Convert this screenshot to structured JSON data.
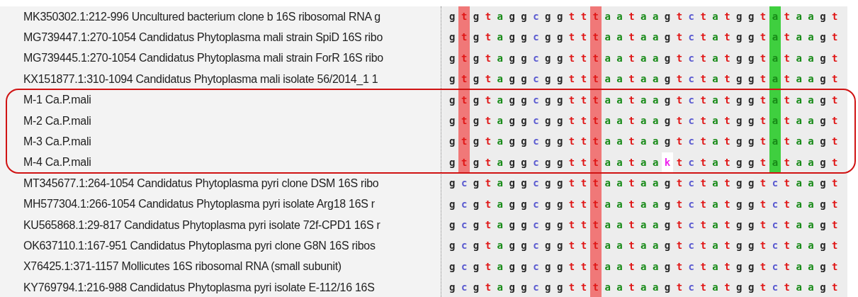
{
  "annotation": {
    "kind": "rounded-frame"
  },
  "rows": [
    {
      "name": "MK350302.1:212-996 Uncultured bacterium clone b 16S ribosomal RNA g",
      "segments": [
        {
          "bases": "g ",
          "highlighted": false
        },
        {
          "bases": "t",
          "highlighted": true,
          "color": "#f07878"
        },
        {
          "bases": " g t a g g c g g t t ",
          "highlighted": false
        },
        {
          "bases": "t",
          "highlighted": true,
          "color": "#f07878"
        },
        {
          "bases": " a a t a a g t c t a t g g t ",
          "highlighted": false
        },
        {
          "bases": "a",
          "highlighted": true,
          "color": "#3fcf3f"
        },
        {
          "bases": " t a a g t",
          "highlighted": false
        }
      ]
    },
    {
      "name": "MG739447.1:270-1054 Candidatus Phytoplasma mali strain SpiD 16S ribo",
      "segments": [
        {
          "bases": "g ",
          "highlighted": false
        },
        {
          "bases": "t",
          "highlighted": true,
          "color": "#f07878"
        },
        {
          "bases": " g t a g g c g g t t ",
          "highlighted": false
        },
        {
          "bases": "t",
          "highlighted": true,
          "color": "#f07878"
        },
        {
          "bases": " a a t a a g t c t a t g g t ",
          "highlighted": false
        },
        {
          "bases": "a",
          "highlighted": true,
          "color": "#3fcf3f"
        },
        {
          "bases": " t a a g t",
          "highlighted": false
        }
      ]
    },
    {
      "name": "MG739445.1:270-1054 Candidatus Phytoplasma mali strain ForR 16S ribo",
      "segments": [
        {
          "bases": "g ",
          "highlighted": false
        },
        {
          "bases": "t",
          "highlighted": true,
          "color": "#f07878"
        },
        {
          "bases": " g t a g g c g g t t ",
          "highlighted": false
        },
        {
          "bases": "t",
          "highlighted": true,
          "color": "#f07878"
        },
        {
          "bases": " a a t a a g t c t a t g g t ",
          "highlighted": false
        },
        {
          "bases": "a",
          "highlighted": true,
          "color": "#3fcf3f"
        },
        {
          "bases": " t a a g t",
          "highlighted": false
        }
      ]
    },
    {
      "name": "KX151877.1:310-1094 Candidatus Phytoplasma mali isolate 56/2014_1 1",
      "segments": [
        {
          "bases": "g ",
          "highlighted": false
        },
        {
          "bases": "t",
          "highlighted": true,
          "color": "#f07878"
        },
        {
          "bases": " g t a g g c g g t t ",
          "highlighted": false
        },
        {
          "bases": "t",
          "highlighted": true,
          "color": "#f07878"
        },
        {
          "bases": " a a t a a g t c t a t g g t ",
          "highlighted": false
        },
        {
          "bases": "a",
          "highlighted": true,
          "color": "#3fcf3f"
        },
        {
          "bases": " t a a g t",
          "highlighted": false
        }
      ]
    },
    {
      "name": "M-1 Ca.P.mali",
      "segments": [
        {
          "bases": "g ",
          "highlighted": false
        },
        {
          "bases": "t",
          "highlighted": true,
          "color": "#f07878"
        },
        {
          "bases": " g t a g g c g g t t ",
          "highlighted": false
        },
        {
          "bases": "t",
          "highlighted": true,
          "color": "#f07878"
        },
        {
          "bases": " a a t a a g t c t a t g g t ",
          "highlighted": false
        },
        {
          "bases": "a",
          "highlighted": true,
          "color": "#3fcf3f"
        },
        {
          "bases": " t a a g t",
          "highlighted": false
        }
      ]
    },
    {
      "name": "M-2 Ca.P.mali",
      "segments": [
        {
          "bases": "g ",
          "highlighted": false
        },
        {
          "bases": "t",
          "highlighted": true,
          "color": "#f07878"
        },
        {
          "bases": " g t a g g c g g t t ",
          "highlighted": false
        },
        {
          "bases": "t",
          "highlighted": true,
          "color": "#f07878"
        },
        {
          "bases": " a a t a a g t c t a t g g t ",
          "highlighted": false
        },
        {
          "bases": "a",
          "highlighted": true,
          "color": "#3fcf3f"
        },
        {
          "bases": " t a a g t",
          "highlighted": false
        }
      ]
    },
    {
      "name": "M-3 Ca.P.mali",
      "segments": [
        {
          "bases": "g ",
          "highlighted": false
        },
        {
          "bases": "t",
          "highlighted": true,
          "color": "#f07878"
        },
        {
          "bases": " g t a g g c g g t t ",
          "highlighted": false
        },
        {
          "bases": "t",
          "highlighted": true,
          "color": "#f07878"
        },
        {
          "bases": " a a t a a g t c t a t g g t ",
          "highlighted": false
        },
        {
          "bases": "a",
          "highlighted": true,
          "color": "#3fcf3f"
        },
        {
          "bases": " t a a g t",
          "highlighted": false
        }
      ]
    },
    {
      "name": "M-4 Ca.P.mali",
      "segments": [
        {
          "bases": "g ",
          "highlighted": false
        },
        {
          "bases": "t",
          "highlighted": true,
          "color": "#f07878"
        },
        {
          "bases": " g t a g g c g g t t ",
          "highlighted": false
        },
        {
          "bases": "t",
          "highlighted": true,
          "color": "#f07878"
        },
        {
          "bases": " a a t a a ",
          "highlighted": false
        },
        {
          "bases": "k",
          "highlighted": true,
          "color": "#ffffff"
        },
        {
          "bases": " t c t a t g g t ",
          "highlighted": false
        },
        {
          "bases": "a",
          "highlighted": true,
          "color": "#3fcf3f"
        },
        {
          "bases": " t a a g t",
          "highlighted": false
        }
      ]
    },
    {
      "name": "MT345677.1:264-1054 Candidatus Phytoplasma pyri clone DSM 16S ribo",
      "segments": [
        {
          "bases": "g c g t a g g c g g t t ",
          "highlighted": false
        },
        {
          "bases": "t",
          "highlighted": true,
          "color": "#f07878"
        },
        {
          "bases": " a a t a a g t c t a t g g t c t a a g t",
          "highlighted": false
        }
      ]
    },
    {
      "name": "MH577304.1:266-1054 Candidatus Phytoplasma pyri isolate Arg18 16S r",
      "segments": [
        {
          "bases": "g c g t a g g c g g t t ",
          "highlighted": false
        },
        {
          "bases": "t",
          "highlighted": true,
          "color": "#f07878"
        },
        {
          "bases": " a a t a a g t c t a t g g t c t a a g t",
          "highlighted": false
        }
      ]
    },
    {
      "name": "KU565868.1:29-817 Candidatus Phytoplasma pyri isolate 72f-CPD1 16S r",
      "segments": [
        {
          "bases": "g c g t a g g c g g t t ",
          "highlighted": false
        },
        {
          "bases": "t",
          "highlighted": true,
          "color": "#f07878"
        },
        {
          "bases": " a a t a a g t c t a t g g t c t a a g t",
          "highlighted": false
        }
      ]
    },
    {
      "name": "OK637110.1:167-951 Candidatus Phytoplasma pyri clone G8N 16S ribos",
      "segments": [
        {
          "bases": "g c g t a g g c g g t t ",
          "highlighted": false
        },
        {
          "bases": "t",
          "highlighted": true,
          "color": "#f07878"
        },
        {
          "bases": " a a t a a g t c t a t g g t c t a a g t",
          "highlighted": false
        }
      ]
    },
    {
      "name": "X76425.1:371-1157 Mollicutes 16S ribosomal RNA (small subunit)",
      "segments": [
        {
          "bases": "g c g t a g g c g g t t ",
          "highlighted": false
        },
        {
          "bases": "t",
          "highlighted": true,
          "color": "#f07878"
        },
        {
          "bases": " a a t a a g t c t a t g g t c t a a g t",
          "highlighted": false
        }
      ]
    },
    {
      "name": "KY769794.1:216-988 Candidatus Phytoplasma pyri isolate E-112/16 16S",
      "segments": [
        {
          "bases": "g c g t a g g c g g t t ",
          "highlighted": false
        },
        {
          "bases": "t",
          "highlighted": true,
          "color": "#f07878"
        },
        {
          "bases": " a a t a a g t c t a t g g t c t a a g t",
          "highlighted": false
        }
      ]
    }
  ]
}
